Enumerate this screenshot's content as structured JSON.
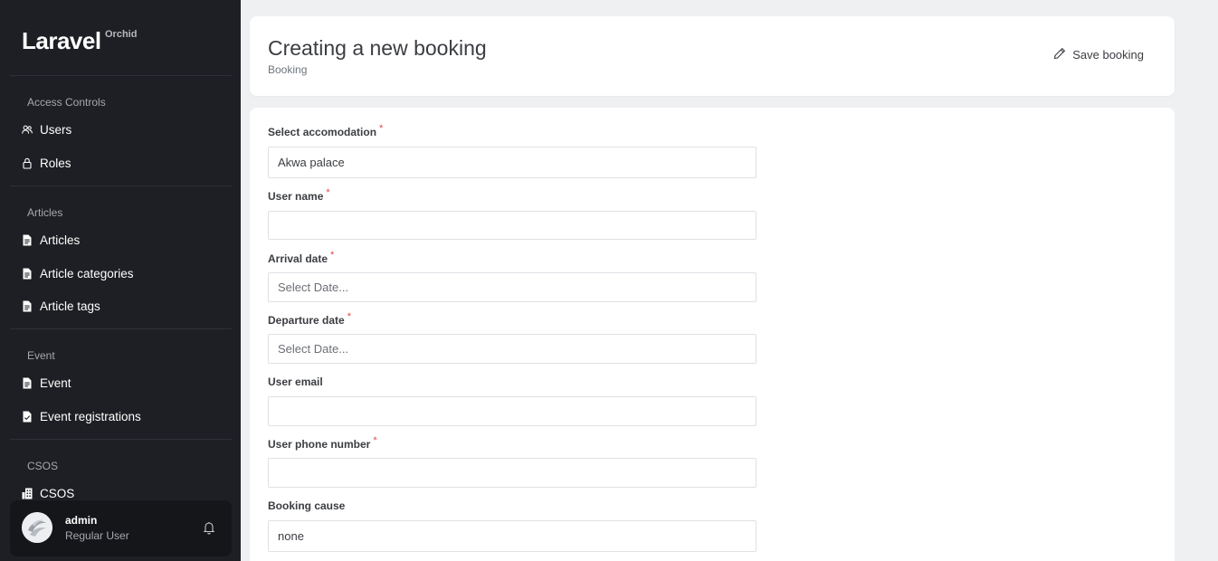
{
  "brand": {
    "name": "Laravel",
    "sup": "Orchid"
  },
  "sidebar": {
    "sections": [
      {
        "title": "Access Controls",
        "items": [
          {
            "label": "Users",
            "icon": "users-icon"
          },
          {
            "label": "Roles",
            "icon": "lock-icon"
          }
        ]
      },
      {
        "title": "Articles",
        "items": [
          {
            "label": "Articles",
            "icon": "document-icon"
          },
          {
            "label": "Article categories",
            "icon": "document-icon"
          },
          {
            "label": "Article tags",
            "icon": "document-icon"
          }
        ]
      },
      {
        "title": "Event",
        "items": [
          {
            "label": "Event",
            "icon": "document-icon"
          },
          {
            "label": "Event registrations",
            "icon": "document-check-icon"
          }
        ]
      },
      {
        "title": "CSOS",
        "items": [
          {
            "label": "CSOS",
            "icon": "building-icon"
          }
        ]
      }
    ]
  },
  "user": {
    "name": "admin",
    "role": "Regular User"
  },
  "header": {
    "title": "Creating a new booking",
    "subtitle": "Booking",
    "save_label": "Save booking"
  },
  "form": {
    "fields": [
      {
        "label": "Select accomodation",
        "required": "*",
        "value": "Akwa palace",
        "placeholder": ""
      },
      {
        "label": "User name",
        "required": "*",
        "value": "",
        "placeholder": ""
      },
      {
        "label": "Arrival date",
        "required": "*",
        "value": "",
        "placeholder": "Select Date..."
      },
      {
        "label": "Departure date",
        "required": "*",
        "value": "",
        "placeholder": "Select Date..."
      },
      {
        "label": "User email",
        "required": "",
        "value": "",
        "placeholder": ""
      },
      {
        "label": "User phone number",
        "required": "*",
        "value": "",
        "placeholder": ""
      },
      {
        "label": "Booking cause",
        "required": "",
        "value": "none",
        "placeholder": ""
      }
    ]
  },
  "colors": {
    "sidebar_bg": "#1e1f24",
    "page_bg": "#eff0f2",
    "required": "#e54646"
  }
}
